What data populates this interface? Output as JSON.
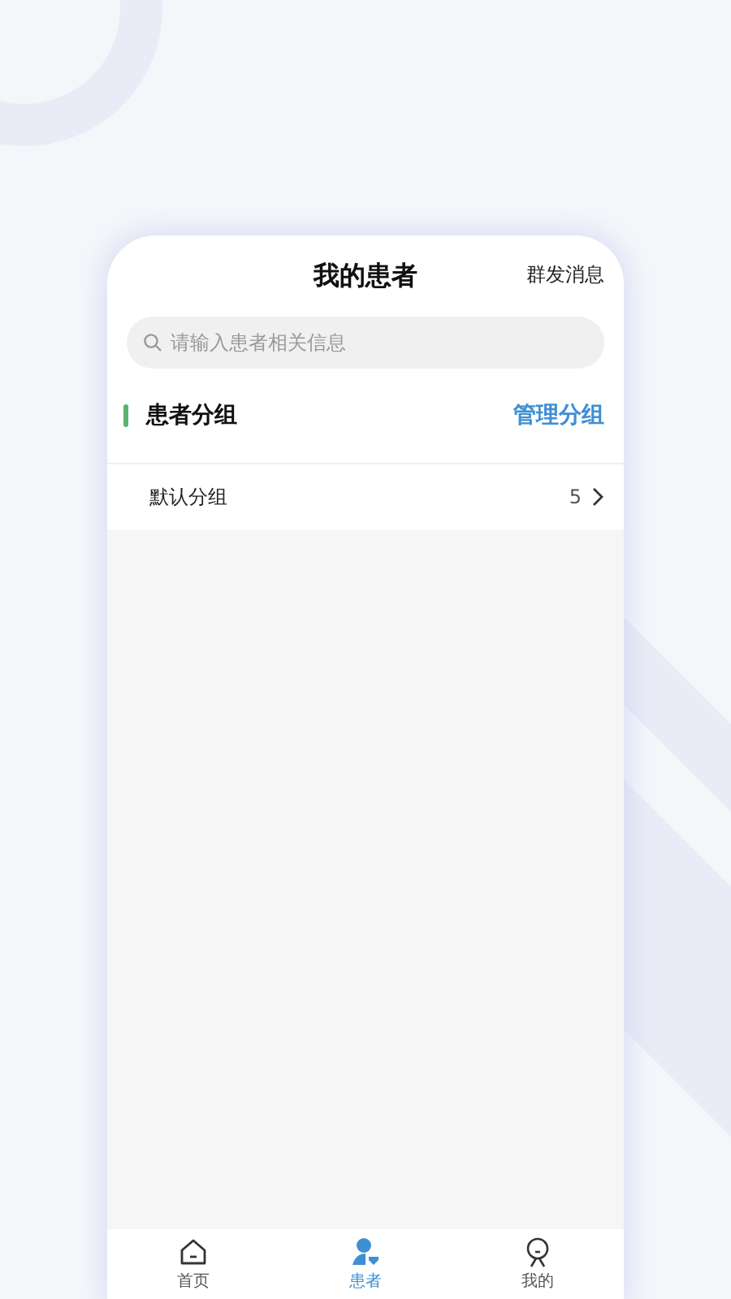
{
  "header": {
    "title": "我的患者",
    "action": "群发消息"
  },
  "search": {
    "placeholder": "请输入患者相关信息"
  },
  "section": {
    "title": "患者分组",
    "action": "管理分组"
  },
  "groups": [
    {
      "name": "默认分组",
      "count": "5"
    }
  ],
  "tabs": [
    {
      "label": "首页",
      "kind": "home",
      "selected": false
    },
    {
      "label": "患者",
      "kind": "patient",
      "selected": true
    },
    {
      "label": "我的",
      "kind": "profile",
      "selected": false
    }
  ]
}
